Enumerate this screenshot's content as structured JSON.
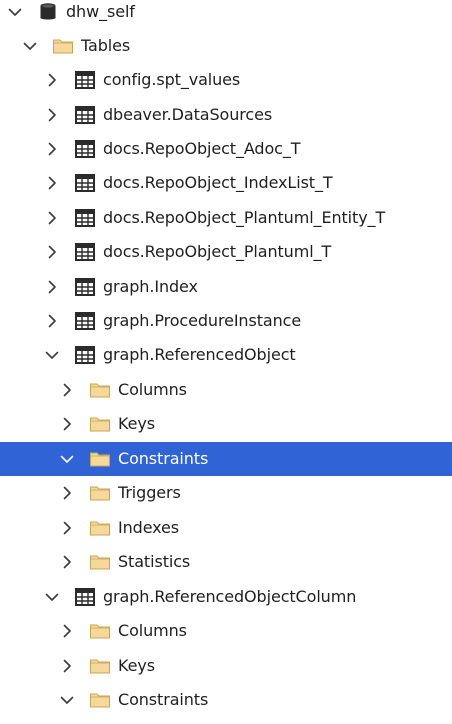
{
  "tree": [
    {
      "label": "dhw_self",
      "icon": "database-icon",
      "level": 0,
      "state": "expanded",
      "selected": false
    },
    {
      "label": "Tables",
      "icon": "folder-icon",
      "level": 1,
      "state": "expanded",
      "selected": false
    },
    {
      "label": "config.spt_values",
      "icon": "table-icon",
      "level": 2,
      "state": "collapsed",
      "selected": false
    },
    {
      "label": "dbeaver.DataSources",
      "icon": "table-icon",
      "level": 2,
      "state": "collapsed",
      "selected": false
    },
    {
      "label": "docs.RepoObject_Adoc_T",
      "icon": "table-icon",
      "level": 2,
      "state": "collapsed",
      "selected": false
    },
    {
      "label": "docs.RepoObject_IndexList_T",
      "icon": "table-icon",
      "level": 2,
      "state": "collapsed",
      "selected": false
    },
    {
      "label": "docs.RepoObject_Plantuml_Entity_T",
      "icon": "table-icon",
      "level": 2,
      "state": "collapsed",
      "selected": false
    },
    {
      "label": "docs.RepoObject_Plantuml_T",
      "icon": "table-icon",
      "level": 2,
      "state": "collapsed",
      "selected": false
    },
    {
      "label": "graph.Index",
      "icon": "table-icon",
      "level": 2,
      "state": "collapsed",
      "selected": false
    },
    {
      "label": "graph.ProcedureInstance",
      "icon": "table-icon",
      "level": 2,
      "state": "collapsed",
      "selected": false
    },
    {
      "label": "graph.ReferencedObject",
      "icon": "table-icon",
      "level": 2,
      "state": "expanded",
      "selected": false
    },
    {
      "label": "Columns",
      "icon": "folder-icon",
      "level": 3,
      "state": "collapsed",
      "selected": false
    },
    {
      "label": "Keys",
      "icon": "folder-icon",
      "level": 3,
      "state": "collapsed",
      "selected": false
    },
    {
      "label": "Constraints",
      "icon": "folder-icon",
      "level": 3,
      "state": "expanded",
      "selected": true
    },
    {
      "label": "Triggers",
      "icon": "folder-icon",
      "level": 3,
      "state": "collapsed",
      "selected": false
    },
    {
      "label": "Indexes",
      "icon": "folder-icon",
      "level": 3,
      "state": "collapsed",
      "selected": false
    },
    {
      "label": "Statistics",
      "icon": "folder-icon",
      "level": 3,
      "state": "collapsed",
      "selected": false
    },
    {
      "label": "graph.ReferencedObjectColumn",
      "icon": "table-icon",
      "level": 2,
      "state": "expanded",
      "selected": false
    },
    {
      "label": "Columns",
      "icon": "folder-icon",
      "level": 3,
      "state": "collapsed",
      "selected": false
    },
    {
      "label": "Keys",
      "icon": "folder-icon",
      "level": 3,
      "state": "collapsed",
      "selected": false
    },
    {
      "label": "Constraints",
      "icon": "folder-icon",
      "level": 3,
      "state": "expanded",
      "selected": false
    }
  ],
  "colors": {
    "selection": "#2f63d6",
    "folder_fill": "#f5d89a",
    "folder_stroke": "#c9a55a",
    "icon_dark": "#2b2b2b",
    "chevron": "#3a3a3a"
  }
}
